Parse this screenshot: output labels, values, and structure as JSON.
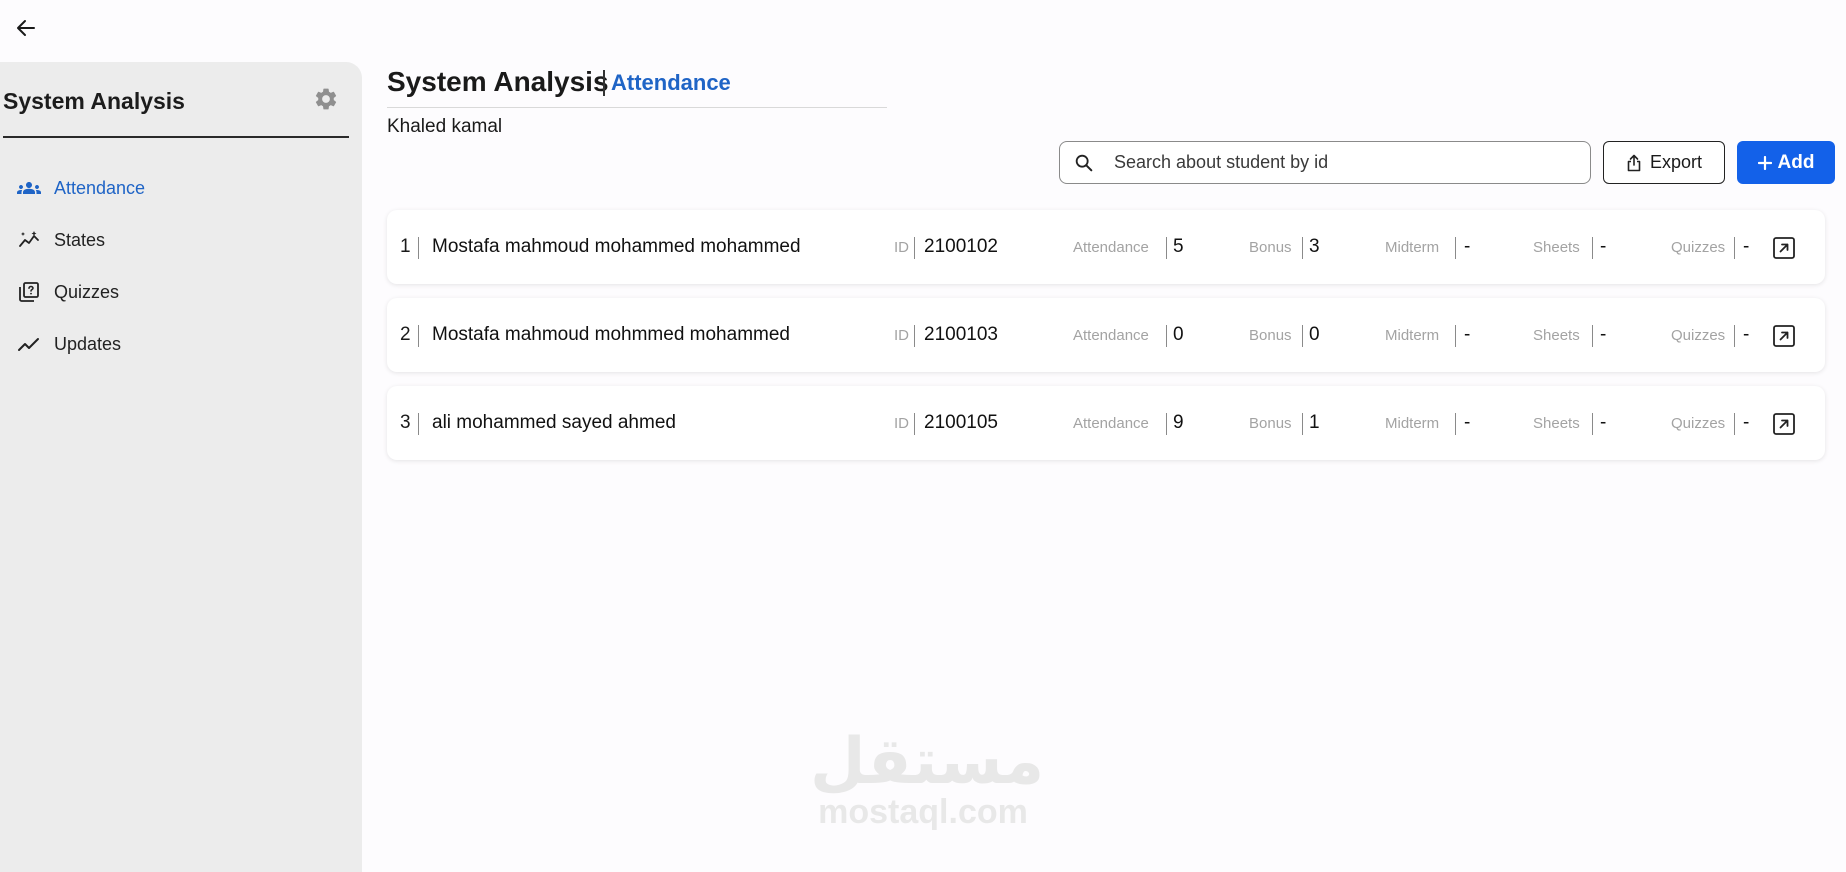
{
  "topbar": {
    "back_icon": "arrow-left-icon"
  },
  "sidebar": {
    "course_title": "System Analysis",
    "settings_icon": "gear-icon",
    "items": [
      {
        "label": "Attendance",
        "icon": "people-icon",
        "active": true
      },
      {
        "label": "States",
        "icon": "chart-sparkle-icon",
        "active": false
      },
      {
        "label": "Quizzes",
        "icon": "quiz-icon",
        "active": false
      },
      {
        "label": "Updates",
        "icon": "trending-icon",
        "active": false
      }
    ]
  },
  "header": {
    "title": "System Analysis",
    "subtitle": "Attendance",
    "instructor": "Khaled kamal"
  },
  "toolbar": {
    "search_placeholder": "Search about student by id",
    "export_label": "Export",
    "add_label": "Add"
  },
  "labels": {
    "id": "ID",
    "attendance": "Attendance",
    "bonus": "Bonus",
    "midterm": "Midterm",
    "sheets": "Sheets",
    "quizzes": "Quizzes"
  },
  "students": [
    {
      "index": "1",
      "name": "Mostafa mahmoud mohammed mohammed",
      "id": "2100102",
      "attendance": "5",
      "bonus": "3",
      "midterm": "-",
      "sheets": "-",
      "quizzes": "-"
    },
    {
      "index": "2",
      "name": "Mostafa mahmoud mohmmed mohammed",
      "id": "2100103",
      "attendance": "0",
      "bonus": "0",
      "midterm": "-",
      "sheets": "-",
      "quizzes": "-"
    },
    {
      "index": "3",
      "name": "ali mohammed sayed ahmed",
      "id": "2100105",
      "attendance": "9",
      "bonus": "1",
      "midterm": "-",
      "sheets": "-",
      "quizzes": "-"
    }
  ],
  "watermark": {
    "arabic": "مستقل",
    "latin": "mostaql.com"
  },
  "colors": {
    "accent": "#1f64c6",
    "add_button": "#1361e9",
    "sidebar_bg": "#ececec"
  }
}
